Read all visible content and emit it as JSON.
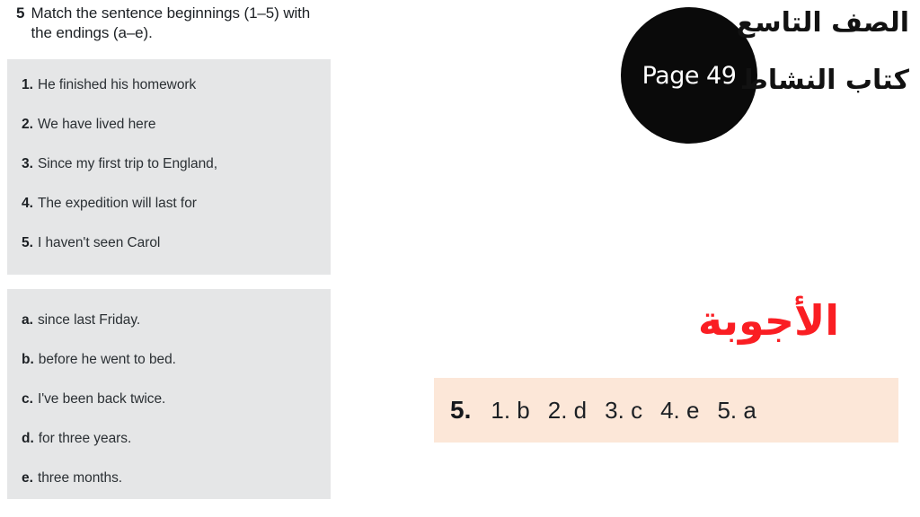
{
  "exercise": {
    "number": "5",
    "instruction": "Match the sentence beginnings (1–5) with the endings (a–e).",
    "beginnings": [
      {
        "marker": "1.",
        "text": "He finished his homework"
      },
      {
        "marker": "2.",
        "text": "We have lived here"
      },
      {
        "marker": "3.",
        "text": "Since my first trip to England,"
      },
      {
        "marker": "4.",
        "text": "The expedition will last for"
      },
      {
        "marker": "5.",
        "text": "I haven't seen Carol"
      }
    ],
    "endings": [
      {
        "marker": "a.",
        "text": "since last Friday."
      },
      {
        "marker": "b.",
        "text": "before he went to bed."
      },
      {
        "marker": "c.",
        "text": "I've been back twice."
      },
      {
        "marker": "d.",
        "text": "for three years."
      },
      {
        "marker": "e.",
        "text": "three months."
      }
    ]
  },
  "badge": {
    "page_label": "Page 49"
  },
  "arabic": {
    "grade": "الصف التاسع",
    "book": "كتاب النشاط",
    "answers_title": "الأجوبة"
  },
  "answers": {
    "exercise_number": "5.",
    "pairs": [
      {
        "label": "1.",
        "value": "b"
      },
      {
        "label": "2.",
        "value": "d"
      },
      {
        "label": "3.",
        "value": "c"
      },
      {
        "label": "4.",
        "value": "e"
      },
      {
        "label": "5.",
        "value": "a"
      }
    ]
  },
  "colors": {
    "box_gray": "#e5e6e7",
    "answer_box_peach": "#fce7d8",
    "answers_title_red": "#fa1e23",
    "badge_black": "#0a0a0a"
  }
}
